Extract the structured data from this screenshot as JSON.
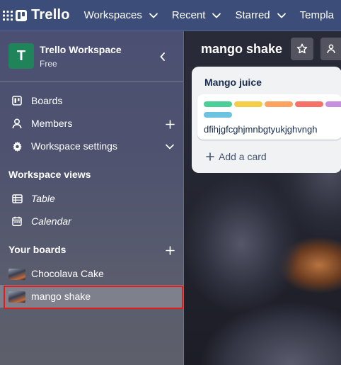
{
  "nav": {
    "brand": "Trello",
    "menus": [
      {
        "label": "Workspaces"
      },
      {
        "label": "Recent"
      },
      {
        "label": "Starred"
      },
      {
        "label": "Templa"
      }
    ]
  },
  "sidebar": {
    "workspace_initial": "T",
    "workspace_name": "Trello Workspace",
    "workspace_plan": "Free",
    "items": [
      {
        "label": "Boards"
      },
      {
        "label": "Members"
      },
      {
        "label": "Workspace settings"
      }
    ],
    "views_heading": "Workspace views",
    "views": [
      {
        "label": "Table"
      },
      {
        "label": "Calendar"
      }
    ],
    "boards_heading": "Your boards",
    "boards": [
      {
        "label": "Chocolava Cake"
      },
      {
        "label": "mango shake"
      }
    ]
  },
  "board": {
    "title": "mango shake",
    "list": {
      "title": "Mango juice",
      "card": {
        "text": "dfihjgfcghjmnbgtyukjghvngh",
        "label_colors": [
          "#4bce97",
          "#f5cd47",
          "#fea362",
          "#f87168",
          "#c78fe0",
          "#6cc3e0"
        ]
      },
      "add_card": "Add a card"
    }
  },
  "colors": {
    "nav_bg": "#3c4d7a",
    "workspace_avatar": "#1f845a",
    "selection_outline": "#e31b1b"
  }
}
